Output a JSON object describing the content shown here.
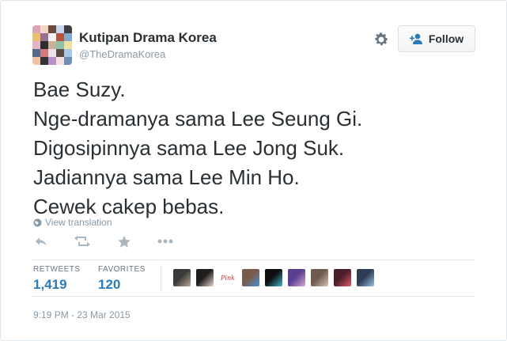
{
  "author": {
    "name": "Kutipan Drama Korea",
    "handle": "@TheDramaKorea"
  },
  "follow_label": "Follow",
  "tweet_lines": [
    "Bae Suzy.",
    "Nge-dramanya sama Lee Seung Gi.",
    "Digosipinnya sama Lee Jong Suk.",
    "Jadiannya sama Lee Min Ho.",
    "Cewek cakep bebas."
  ],
  "translate_label": "View translation",
  "actions": [
    "reply-icon",
    "retweet-icon",
    "favorite-icon",
    "more-icon"
  ],
  "stats": {
    "retweets_label": "RETWEETS",
    "retweets_value": "1,419",
    "favorites_label": "FAVORITES",
    "favorites_value": "120"
  },
  "favoriters": [
    {
      "colors": [
        "#3a3a3a",
        "#b8a89a"
      ]
    },
    {
      "colors": [
        "#1d1d1d",
        "#e8d7cd"
      ]
    },
    {
      "colors": [
        "#ffffff",
        "#d0303a"
      ],
      "text": "Pink"
    },
    {
      "colors": [
        "#7a5a48",
        "#4b8fd6"
      ]
    },
    {
      "colors": [
        "#0f0f0f",
        "#3fb7c9"
      ]
    },
    {
      "colors": [
        "#5a3f8f",
        "#d9a7d6"
      ]
    },
    {
      "colors": [
        "#6f5a4f",
        "#d8c4b8"
      ]
    },
    {
      "colors": [
        "#4a1f2a",
        "#e25a6b"
      ]
    },
    {
      "colors": [
        "#2f3c55",
        "#9cc0e8"
      ]
    }
  ],
  "timestamp": "9:19 PM - 23 Mar 2015",
  "colors": {
    "link": "#2b7bb9",
    "muted": "#8899a6",
    "text": "#292f33"
  }
}
